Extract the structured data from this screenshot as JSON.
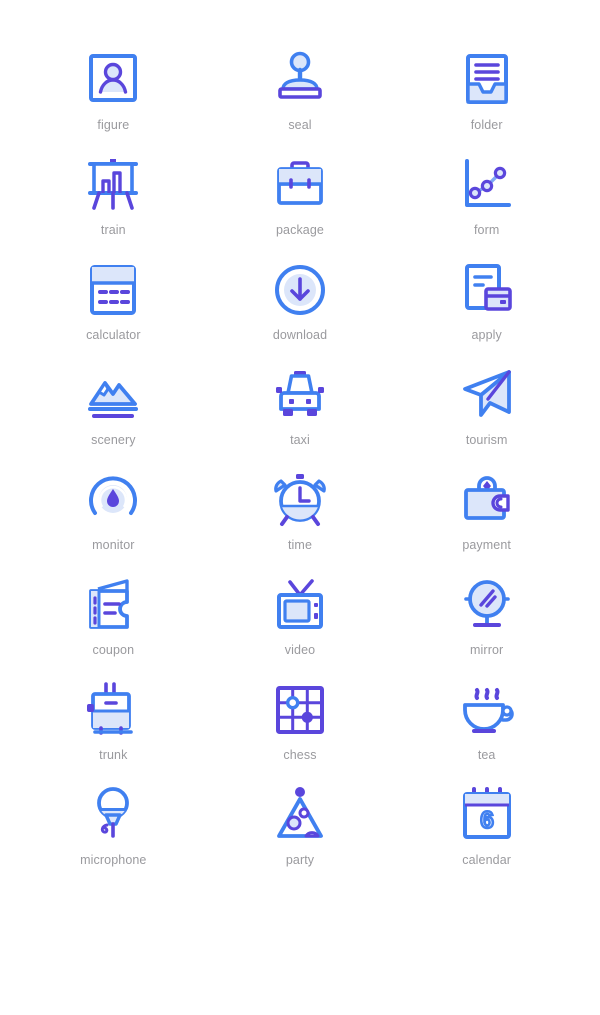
{
  "palette": {
    "stroke_blue": "#4080F0",
    "accent_purple": "#5A46DC",
    "fill_light": "#DCE6FA",
    "label_gray": "#9a9a9e",
    "background": "#FFFFFF"
  },
  "grid": {
    "columns": 3,
    "rows": 8,
    "total_icons": 24
  },
  "icons": [
    {
      "id": "figure",
      "label": "figure",
      "icon_name": "figure-portrait-icon"
    },
    {
      "id": "seal",
      "label": "seal",
      "icon_name": "seal-stamp-icon"
    },
    {
      "id": "folder",
      "label": "folder",
      "icon_name": "folder-document-icon"
    },
    {
      "id": "train",
      "label": "train",
      "icon_name": "presentation-board-chart-icon"
    },
    {
      "id": "package",
      "label": "package",
      "icon_name": "briefcase-package-icon"
    },
    {
      "id": "form",
      "label": "form",
      "icon_name": "line-chart-form-icon"
    },
    {
      "id": "calculator",
      "label": "calculator",
      "icon_name": "calculator-icon"
    },
    {
      "id": "download",
      "label": "download",
      "icon_name": "download-circle-arrow-icon"
    },
    {
      "id": "apply",
      "label": "apply",
      "icon_name": "apply-document-card-icon"
    },
    {
      "id": "scenery",
      "label": "scenery",
      "icon_name": "mountain-scenery-icon"
    },
    {
      "id": "taxi",
      "label": "taxi",
      "icon_name": "taxi-car-icon"
    },
    {
      "id": "tourism",
      "label": "tourism",
      "icon_name": "paper-plane-tourism-icon"
    },
    {
      "id": "monitor",
      "label": "monitor",
      "icon_name": "gauge-droplet-monitor-icon"
    },
    {
      "id": "time",
      "label": "time",
      "icon_name": "alarm-clock-time-icon"
    },
    {
      "id": "payment",
      "label": "payment",
      "icon_name": "wallet-payment-icon"
    },
    {
      "id": "coupon",
      "label": "coupon",
      "icon_name": "coupon-ticket-icon"
    },
    {
      "id": "video",
      "label": "video",
      "icon_name": "television-video-icon"
    },
    {
      "id": "mirror",
      "label": "mirror",
      "icon_name": "mirror-stand-icon"
    },
    {
      "id": "trunk",
      "label": "trunk",
      "icon_name": "trunk-suitcase-icon"
    },
    {
      "id": "chess",
      "label": "chess",
      "icon_name": "chess-board-icon"
    },
    {
      "id": "tea",
      "label": "tea",
      "icon_name": "tea-cup-icon"
    },
    {
      "id": "microphone",
      "label": "microphone",
      "icon_name": "microphone-icon"
    },
    {
      "id": "party",
      "label": "party",
      "icon_name": "party-hat-icon"
    },
    {
      "id": "calendar",
      "label": "calendar",
      "icon_name": "calendar-icon",
      "day_number": "6"
    }
  ]
}
